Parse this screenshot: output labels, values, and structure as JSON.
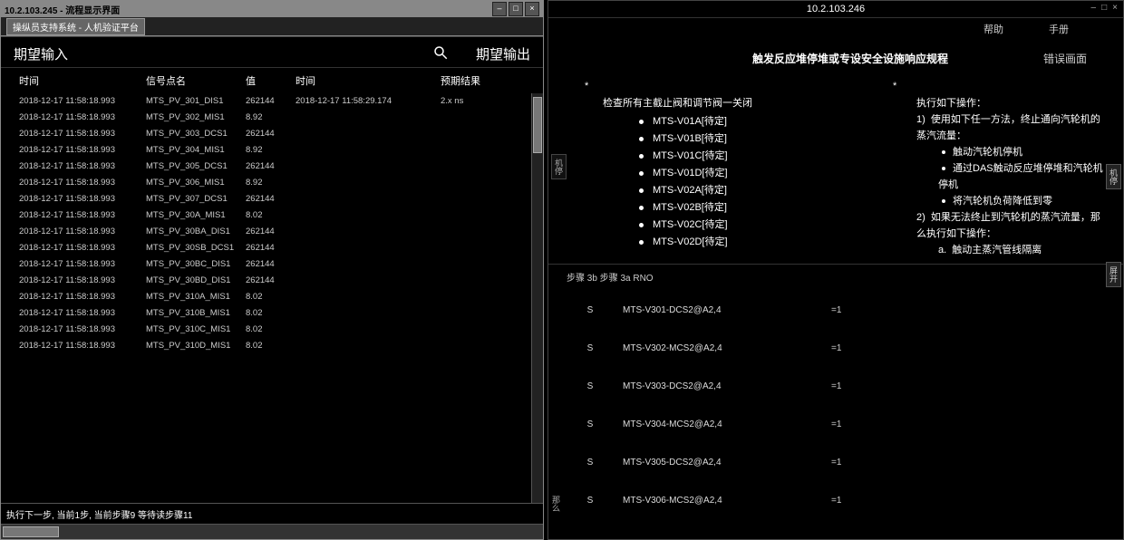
{
  "left": {
    "titlebar": "10.2.103.245  -  流程显示界面",
    "subtitle": "操纵员支持系统 - 人机验证平台",
    "pane1_title": "期望输入",
    "pane2_title": "期望输出",
    "headers": {
      "time": "时间",
      "point": "信号点名",
      "value": "值",
      "time2": "时间",
      "result": "预期结果"
    },
    "rows": [
      {
        "t": "2018-12-17 11:58:18.993",
        "p": "MTS_PV_301_DIS1",
        "v": "262144"
      },
      {
        "t": "2018-12-17 11:58:18.993",
        "p": "MTS_PV_302_MIS1",
        "v": "8.92"
      },
      {
        "t": "2018-12-17 11:58:18.993",
        "p": "MTS_PV_303_DCS1",
        "v": "262144"
      },
      {
        "t": "2018-12-17 11:58:18.993",
        "p": "MTS_PV_304_MIS1",
        "v": "8.92"
      },
      {
        "t": "2018-12-17 11:58:18.993",
        "p": "MTS_PV_305_DCS1",
        "v": "262144"
      },
      {
        "t": "2018-12-17 11:58:18.993",
        "p": "MTS_PV_306_MIS1",
        "v": "8.92"
      },
      {
        "t": "2018-12-17 11:58:18.993",
        "p": "MTS_PV_307_DCS1",
        "v": "262144"
      },
      {
        "t": "2018-12-17 11:58:18.993",
        "p": "MTS_PV_30A_MIS1",
        "v": "8.02"
      },
      {
        "t": "2018-12-17 11:58:18.993",
        "p": "MTS_PV_30BA_DIS1",
        "v": "262144"
      },
      {
        "t": "2018-12-17 11:58:18.993",
        "p": "MTS_PV_30SB_DCS1",
        "v": "262144"
      },
      {
        "t": "2018-12-17 11:58:18.993",
        "p": "MTS_PV_30BC_DIS1",
        "v": "262144"
      },
      {
        "t": "2018-12-17 11:58:18.993",
        "p": "MTS_PV_30BD_DIS1",
        "v": "262144"
      },
      {
        "t": "2018-12-17 11:58:18.993",
        "p": "MTS_PV_310A_MIS1",
        "v": "8.02"
      },
      {
        "t": "2018-12-17 11:58:18.993",
        "p": "MTS_PV_310B_MIS1",
        "v": "8.02"
      },
      {
        "t": "2018-12-17 11:58:18.993",
        "p": "MTS_PV_310C_MIS1",
        "v": "8.02"
      },
      {
        "t": "2018-12-17 11:58:18.993",
        "p": "MTS_PV_310D_MIS1",
        "v": "8.02"
      }
    ],
    "out_rows": [
      {
        "t": "2018-12-17 11:58:29.174",
        "r": "2.x ns"
      }
    ],
    "status": "执行下一步, 当前1步, 当前步骤9 等待读步骤11"
  },
  "right": {
    "ip": "10.2.103.246",
    "menu": {
      "help": "帮助",
      "manual": "手册"
    },
    "doc_title": "触发反应堆停堆或专设安全设施响应规程",
    "err_link": "错误画面",
    "section_title": "检查所有主截止阀和调节阀一关闭",
    "valves": [
      "MTS-V01A[待定]",
      "MTS-V01B[待定]",
      "MTS-V01C[待定]",
      "MTS-V01D[待定]",
      "MTS-V02A[待定]",
      "MTS-V02B[待定]",
      "MTS-V02C[待定]",
      "MTS-V02D[待定]"
    ],
    "instruct_title": "执行如下操作：",
    "instruct_1": "使用如下任一方法，终止通向汽轮机的蒸汽流量：",
    "instruct_1a": "触动汽轮机停机",
    "instruct_1b": "通过DAS触动反应堆停堆和汽轮机停机",
    "instruct_1c": "将汽轮机负荷降低到零",
    "instruct_2": "如果无法终止到汽轮机的蒸汽流量，那么执行如下操作：",
    "instruct_2a": "触动主蒸汽管线隔离",
    "step_info": "步骤 3b   步骤 3a RNO",
    "actions": [
      {
        "s": "S",
        "tag": "MTS-V301-DCS2@A2,4",
        "eq": "=1"
      },
      {
        "s": "S",
        "tag": "MTS-V302-MCS2@A2,4",
        "eq": "=1"
      },
      {
        "s": "S",
        "tag": "MTS-V303-DCS2@A2,4",
        "eq": "=1"
      },
      {
        "s": "S",
        "tag": "MTS-V304-MCS2@A2,4",
        "eq": "=1"
      },
      {
        "s": "S",
        "tag": "MTS-V305-DCS2@A2,4",
        "eq": "=1"
      },
      {
        "s": "S",
        "tag": "MTS-V306-MCS2@A2,4",
        "eq": "=1"
      }
    ],
    "side_tabs": {
      "a": "机停",
      "b": "屏开"
    },
    "side_mid": "那么",
    "winbtns": {
      "min": "–",
      "max": "□",
      "close": "×"
    }
  }
}
